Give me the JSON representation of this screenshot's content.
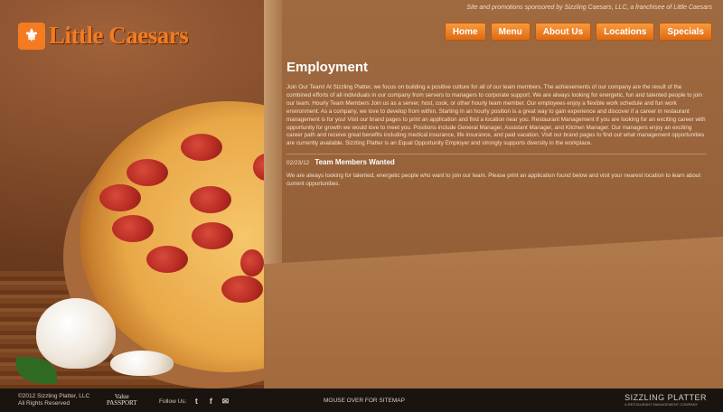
{
  "header": {
    "logo_text": "Little Caesars",
    "tagline": "Site and promotions sponsored by Sizzling Caesars, LLC, a franchisee of Little Caesars"
  },
  "nav": {
    "items": [
      "Home",
      "Menu",
      "About Us",
      "Locations",
      "Specials"
    ]
  },
  "content": {
    "title": "Employment",
    "intro": "Join Our Team! At Sizzling Platter, we focus on building a positive culture for all of our team members. The achievements of our company are the result of the combined efforts of all individuals in our company from servers to managers to corporate support. We are always looking for energetic, fun and talented people to join our team. Hourly Team Members Join us as a server, host, cook, or other hourly team member. Our employees enjoy a flexible work schedule and fun work environment. As a company, we love to develop from within. Starting in an hourly position is a great way to gain experience and discover if a career in restaurant management is for you! Visit our brand pages to print an application and find a location near you. Restaurant Management If you are looking for an exciting career with opportunity for growth we would love to meet you. Positions include General Manager, Assistant Manager, and Kitchen Manager. Our managers enjoy an exciting career path and receive great benefits including medical insurance, life insurance, and paid vacation. Visit our brand pages to find out what management opportunities are currently available. Sizzling Platter is an Equal Opportunity Employer and strongly supports diversity in the workplace.",
    "post": {
      "date": "02/23/12",
      "title": "Team Members Wanted",
      "body": "We are always looking for talented, energetic people who want to join our team. Please print an application found below and visit your nearest location to learn about current opportunities."
    }
  },
  "footer": {
    "copyright": "©2012 Sizzling Platter, LLC",
    "rights": "All Rights Reserved",
    "passport_line1": "Value",
    "passport_line2": "PASSPORT",
    "follow_label": "Follow Us:",
    "social_icons": [
      "twitter-icon",
      "facebook-icon",
      "email-icon"
    ],
    "sitemap": "MOUSE OVER FOR SITEMAP",
    "brand_name": "SIZZLING PLATTER",
    "brand_sub": "A RESTAURANT MANAGEMENT COMPANY"
  },
  "colors": {
    "accent": "#f47b20",
    "box": "#8e5a34",
    "footer": "#1a1410"
  }
}
